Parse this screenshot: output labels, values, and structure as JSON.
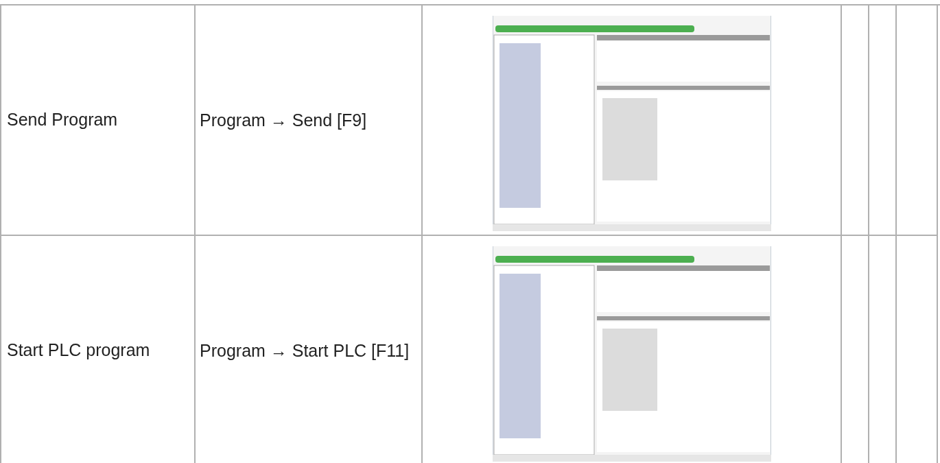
{
  "rows": [
    {
      "action": "Send Program",
      "menu_path": "Program → Send [F9]"
    },
    {
      "action": "Start PLC program",
      "menu_path": "Program → Start PLC [F11]"
    }
  ]
}
